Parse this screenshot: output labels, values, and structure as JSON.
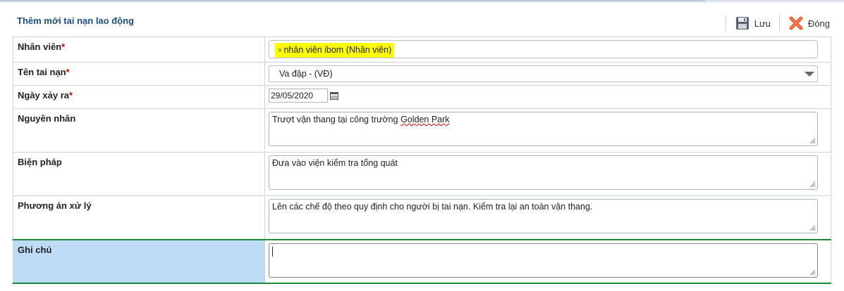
{
  "header": {
    "title": "Thêm mới tai nạn lao động",
    "save_label": "Lưu",
    "close_label": "Đóng"
  },
  "form": {
    "employee": {
      "label": "Nhân viên",
      "required": "*",
      "tag": "nhân viên ibom (Nhân viên)",
      "tag_remove": "×"
    },
    "accident_name": {
      "label": "Tên tai nạn",
      "required": "*",
      "value": "Va đập - (VĐ)"
    },
    "date": {
      "label": "Ngày xảy ra",
      "required": "*",
      "value": "29/05/2020"
    },
    "cause": {
      "label": "Nguyên nhân",
      "value_prefix": "Trượt vận thang tại công trường ",
      "value_misspelled": "Golden Park"
    },
    "measure": {
      "label": "Biện pháp",
      "value": "Đưa vào viện kiểm tra tổng quát"
    },
    "handling": {
      "label": "Phương án xử lý",
      "value": "Lên các chế độ theo quy định cho người bị tai nạn. Kiểm tra lại an toàn vận thang."
    },
    "note": {
      "label": "Ghi chú",
      "value": ""
    }
  },
  "colors": {
    "title": "#1a4f80",
    "required": "#d40000",
    "highlight_row": "#bcdcf6",
    "focus_border": "#1a8a3a",
    "tag_bg": "#ffff00"
  },
  "icons": {
    "save": "floppy-disk-icon",
    "close": "red-x-icon",
    "calendar": "calendar-icon",
    "select": "chevron-down-icon",
    "resize": "resize-grip-icon"
  }
}
